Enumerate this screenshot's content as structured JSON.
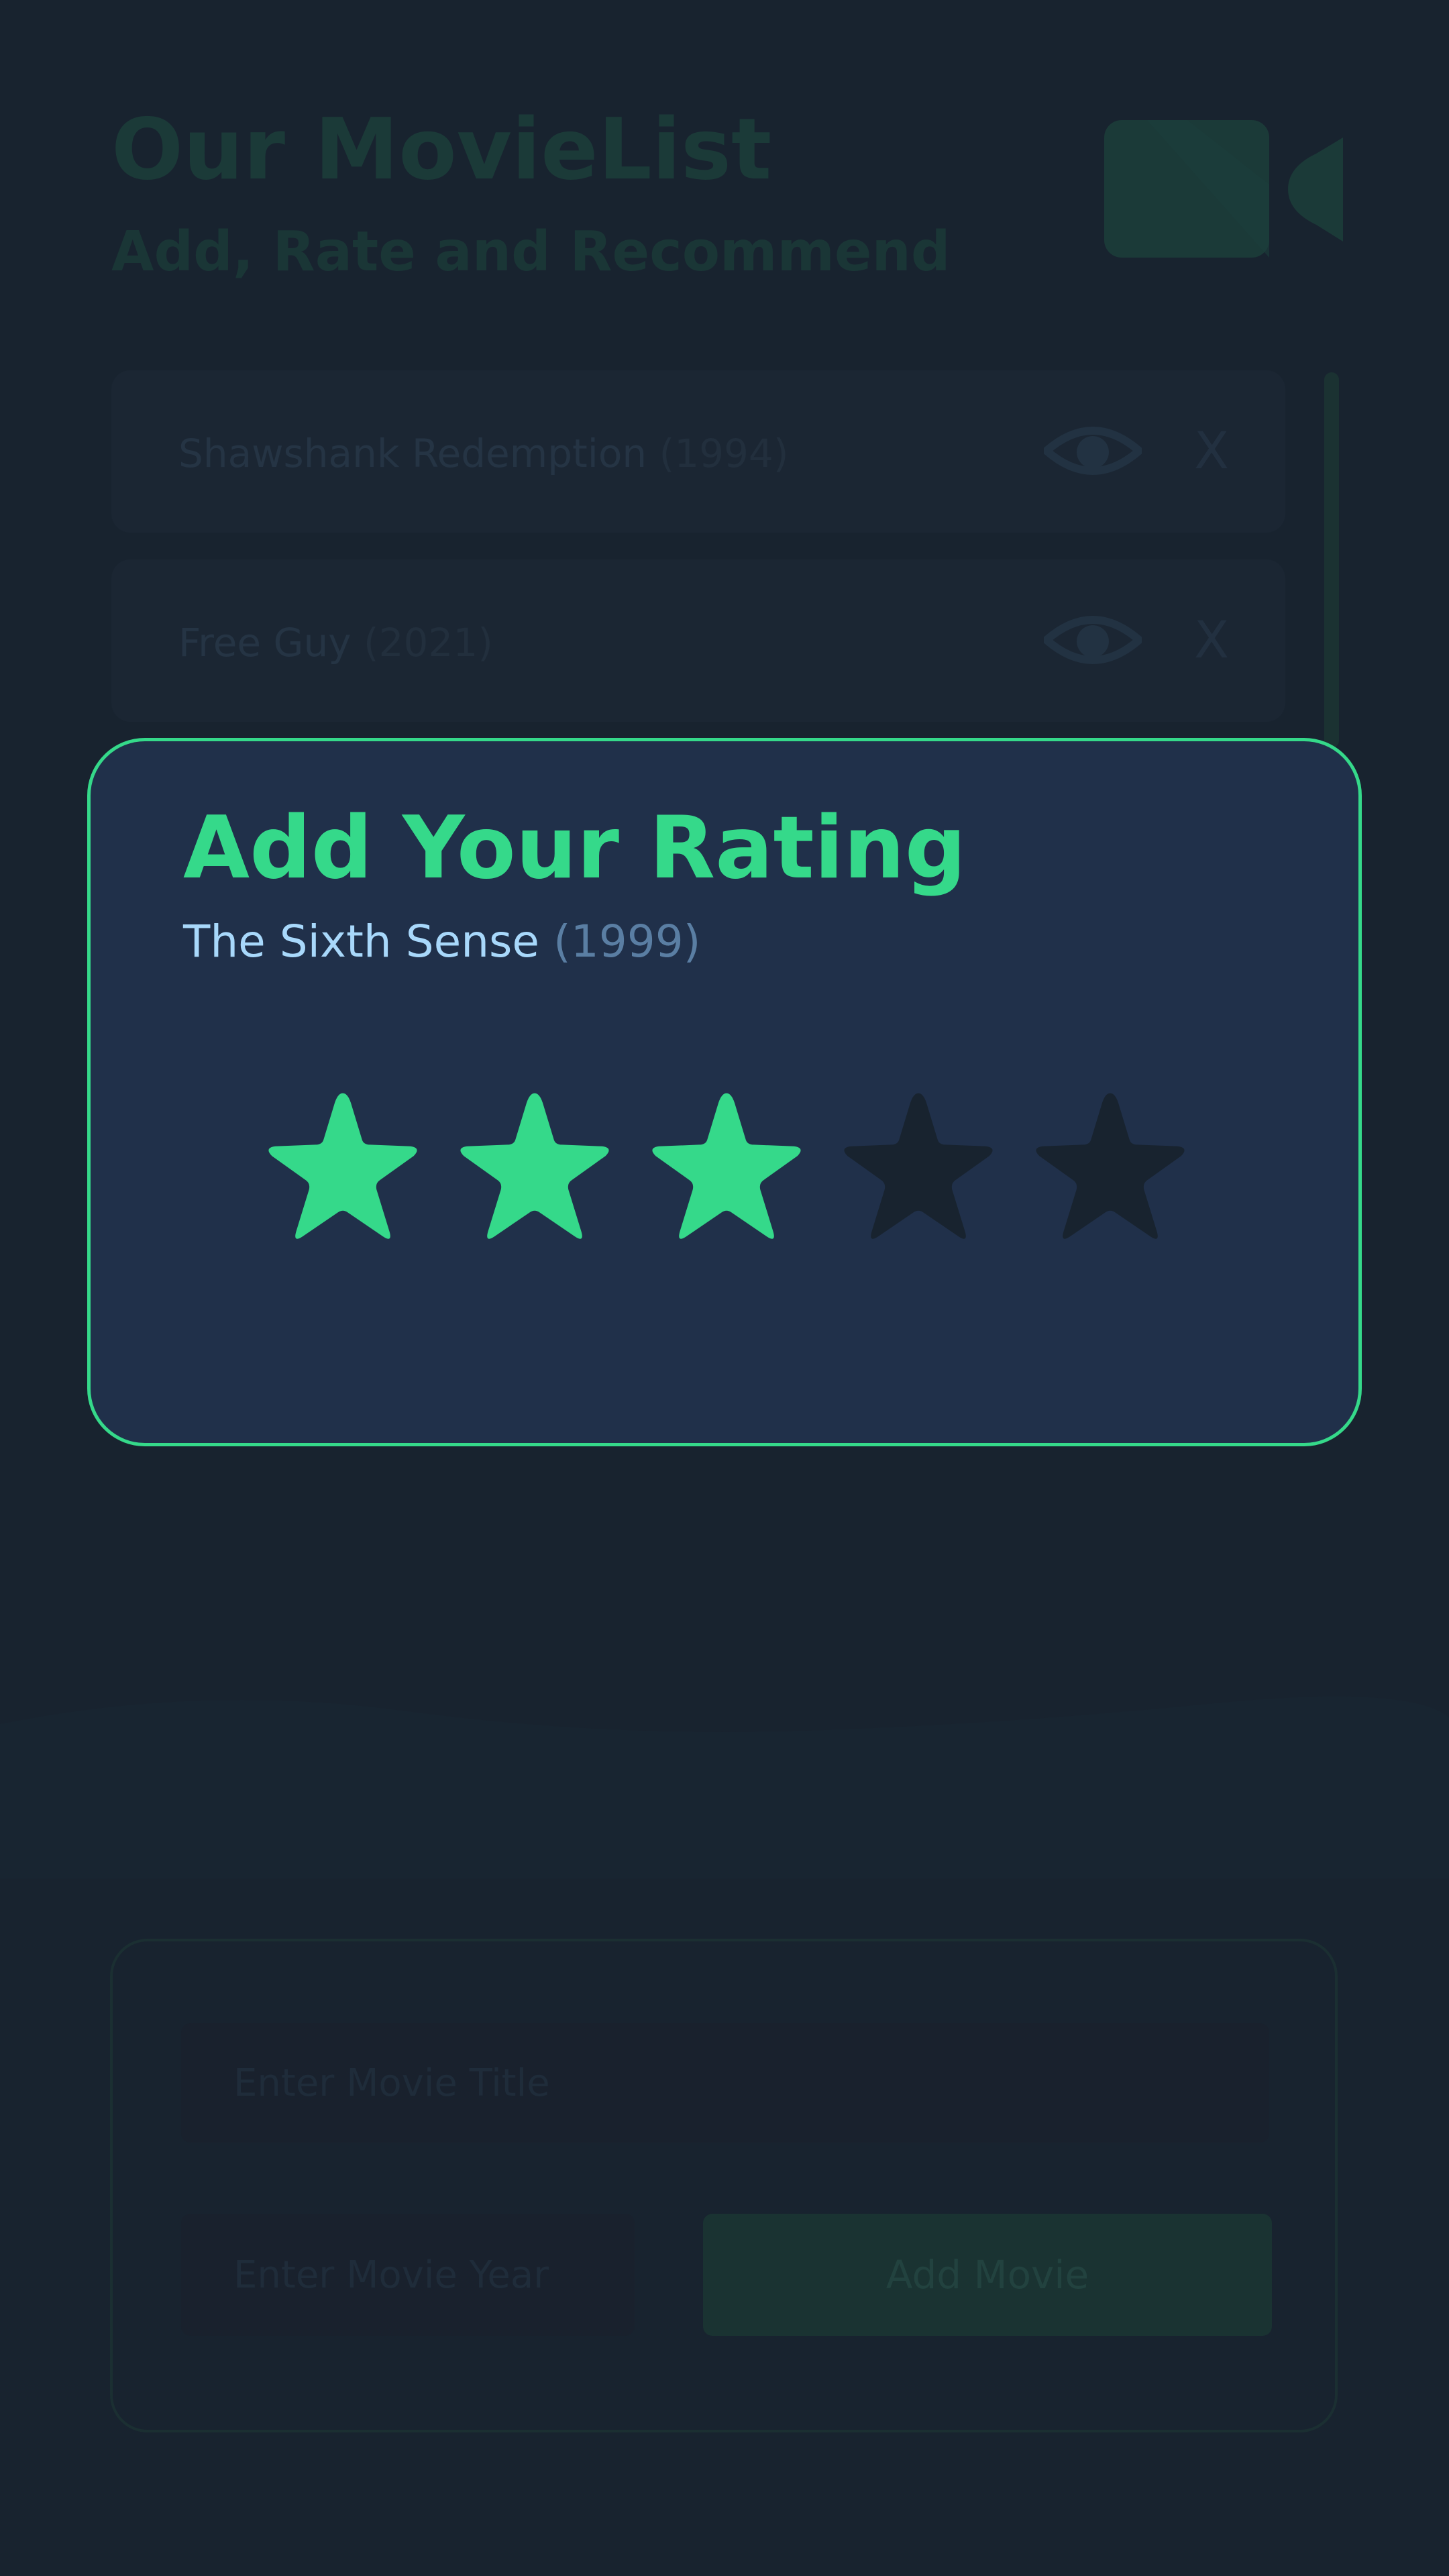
{
  "app": {
    "title": "Our MovieList",
    "subtitle": "Add, Rate and Recommend",
    "logo_icon": "movie-camera-icon"
  },
  "movies": [
    {
      "title": "Shawshank Redemption",
      "year": "(1994)",
      "view_icon": "eye-icon",
      "delete_label": "X"
    },
    {
      "title": "Free Guy",
      "year": "(2021)",
      "view_icon": "eye-icon",
      "delete_label": "X"
    }
  ],
  "add_form": {
    "title_placeholder": "Enter Movie Title",
    "year_placeholder": "Enter Movie Year",
    "button_label": "Add Movie"
  },
  "rating_modal": {
    "heading": "Add Your Rating",
    "movie_title": "The Sixth Sense",
    "movie_year": "(1999)",
    "rating": 3,
    "max_rating": 5,
    "star_icon": "star-icon"
  },
  "colors": {
    "background": "#18232f",
    "accent": "#35d98a",
    "modal_background": "#20304a",
    "star_filled": "#35d98a",
    "star_empty": "#18232f",
    "movie_title_text": "#a8d8fb",
    "movie_year_text": "#5a7ea3"
  }
}
